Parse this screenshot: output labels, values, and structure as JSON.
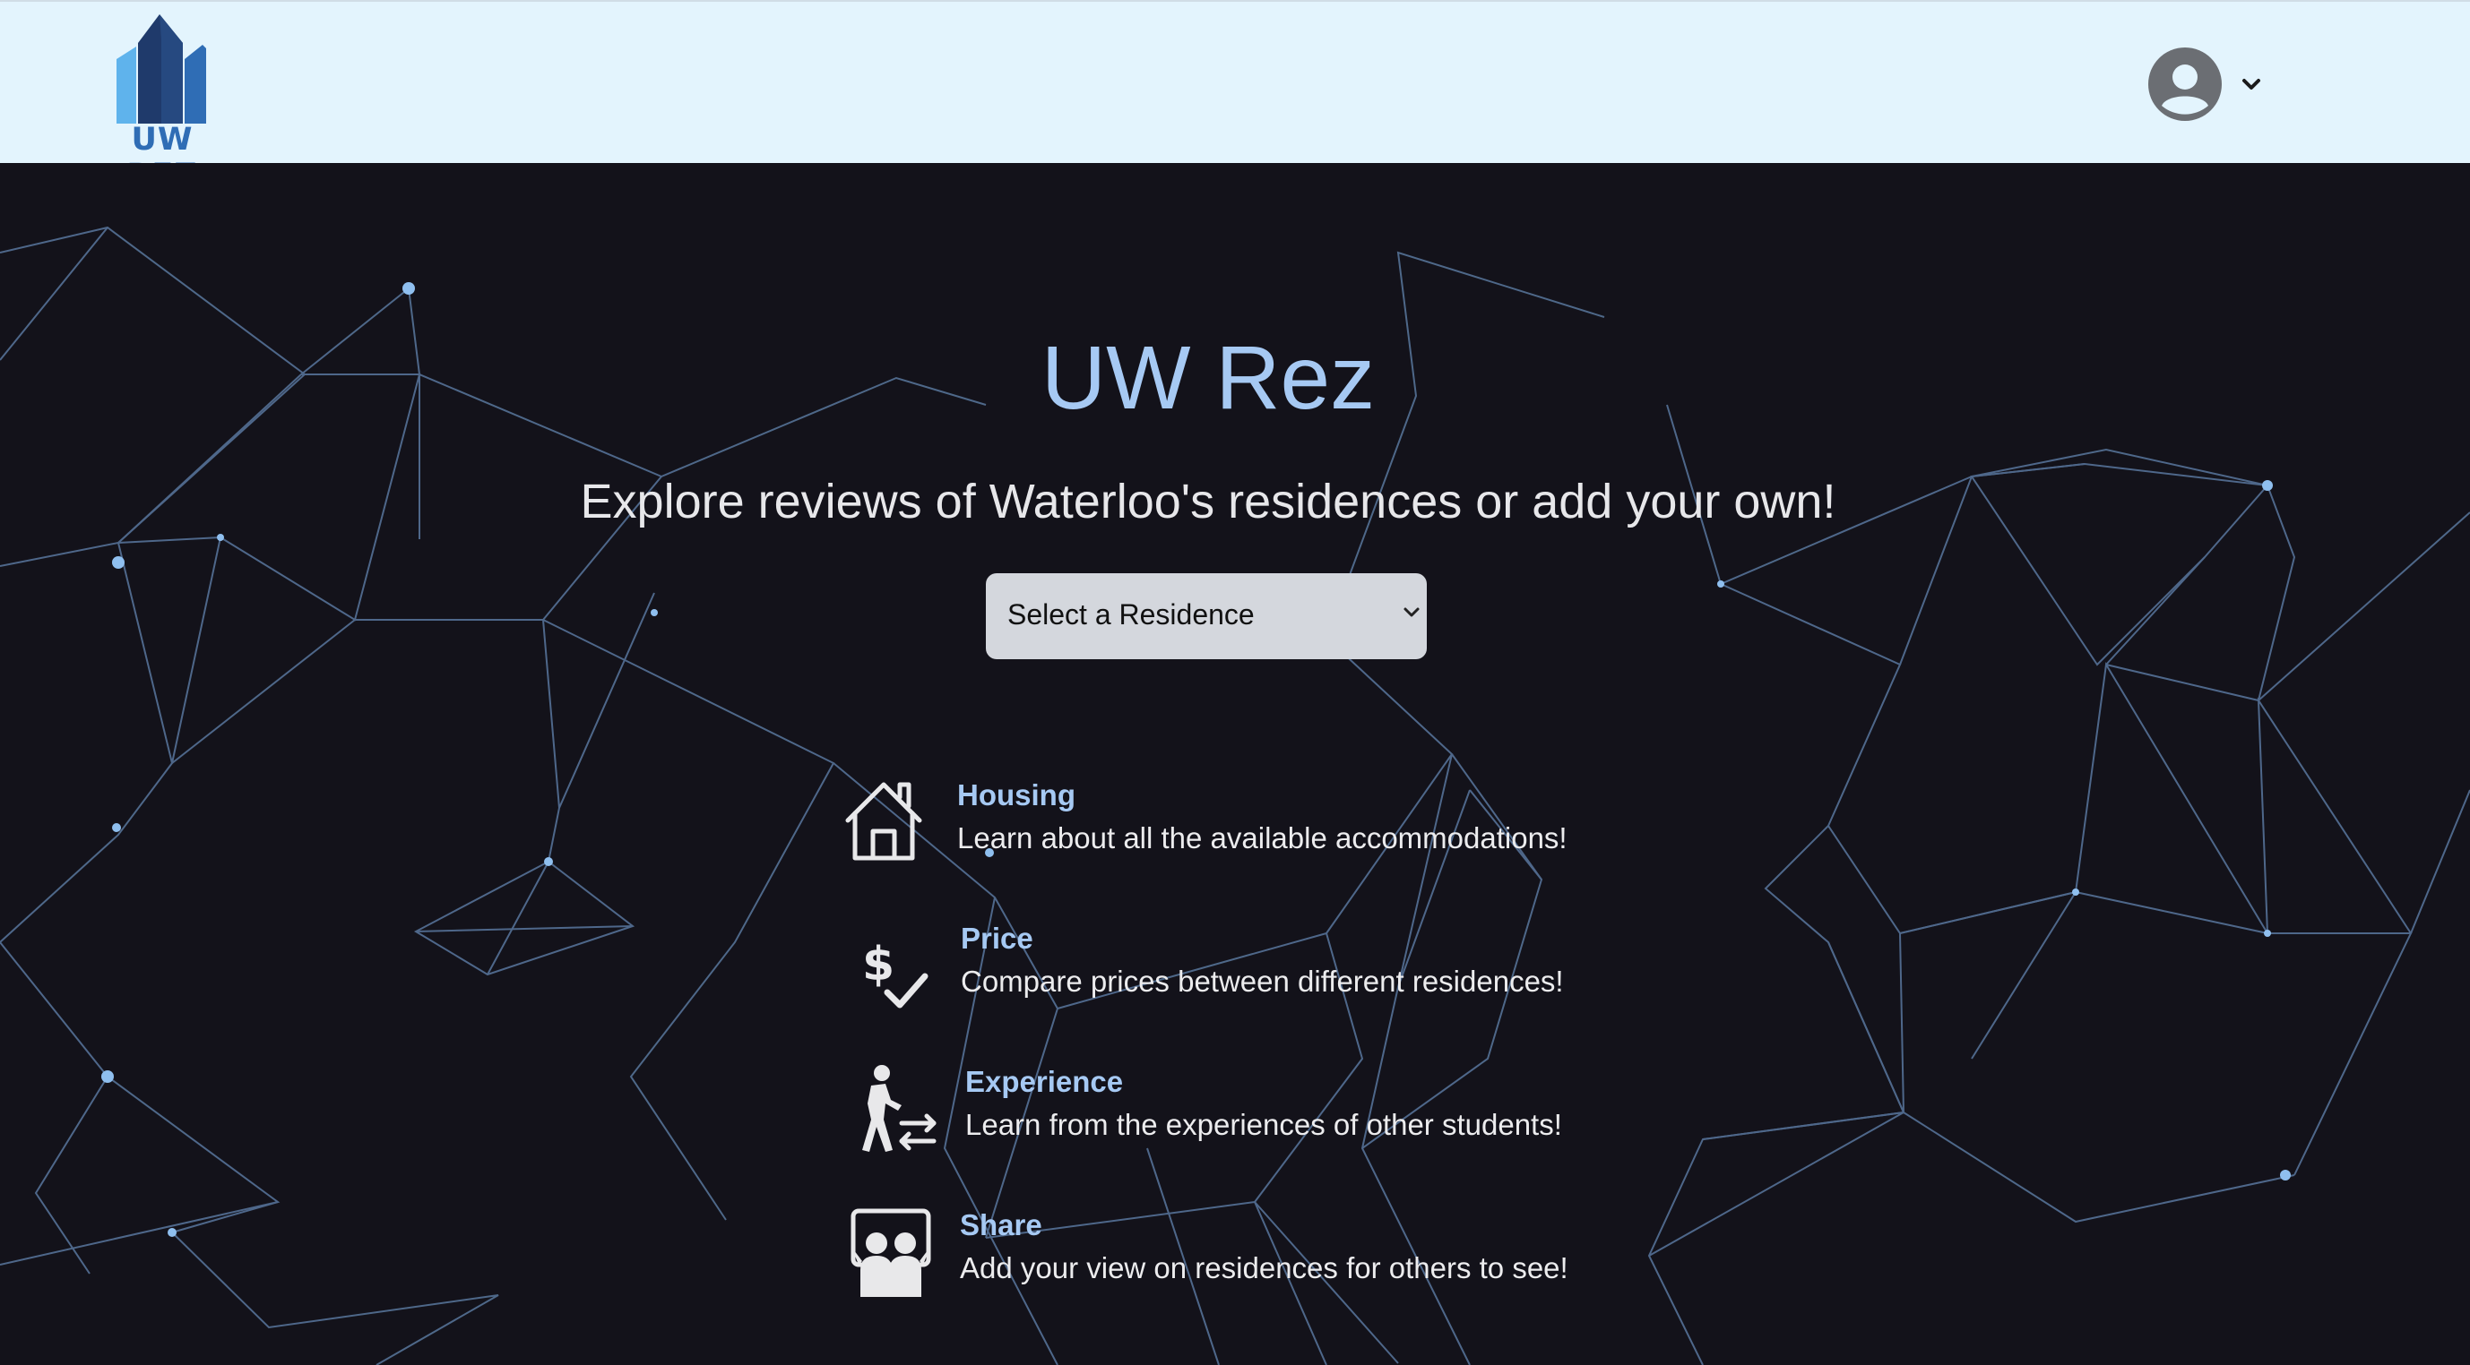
{
  "brand": {
    "logo_text": "UW REZ",
    "colors": {
      "light": "#5fb3ec",
      "dark": "#1f3a6b",
      "mid": "#2f6db5"
    }
  },
  "navbar": {
    "user_icon": "user-circle-icon",
    "dropdown_icon": "chevron-down-icon"
  },
  "hero": {
    "title": "UW Rez",
    "subtitle": "Explore reviews of Waterloo's residences or add your own!",
    "select": {
      "selected": "Select a Residence",
      "icon": "chevron-down-icon"
    }
  },
  "features": [
    {
      "icon": "house-icon",
      "title": "Housing",
      "description": "Learn about all the available accommodations!"
    },
    {
      "icon": "dollar-check-icon",
      "title": "Price",
      "description": "Compare prices between different residences!"
    },
    {
      "icon": "hiker-transfer-icon",
      "title": "Experience",
      "description": "Learn from the experiences of other students!"
    },
    {
      "icon": "share-people-icon",
      "title": "Share",
      "description": "Add your view on residences for others to see!"
    }
  ],
  "colors": {
    "navbar_bg": "#e3f4fd",
    "hero_bg": "#13121a",
    "accent": "#a6c9f3",
    "network_line": "#7faee6"
  }
}
